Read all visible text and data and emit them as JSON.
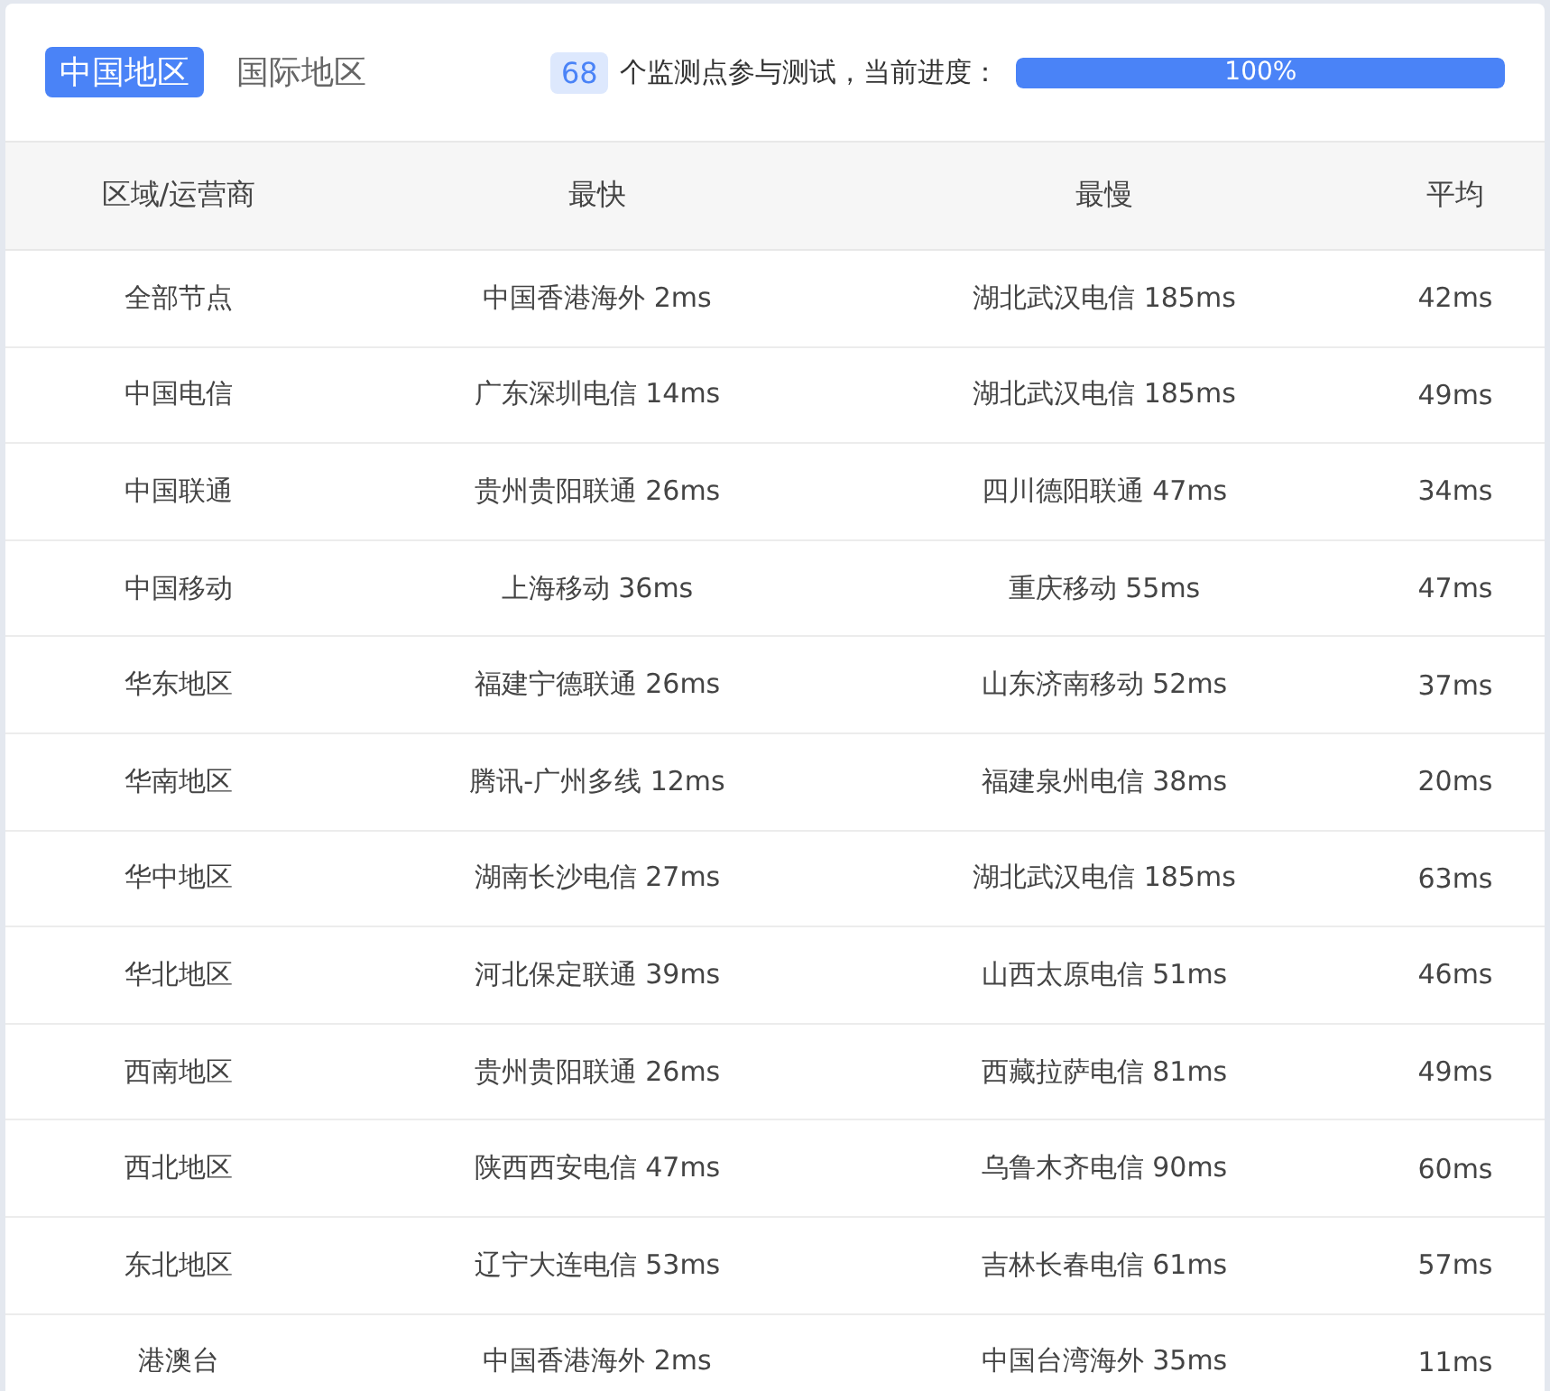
{
  "tabs": [
    {
      "label": "中国地区",
      "selected": true
    },
    {
      "label": "国际地区",
      "selected": false
    }
  ],
  "progress": {
    "count": "68",
    "text": "个监测点参与测试，当前进度：",
    "level": 1,
    "reading": "100%"
  },
  "table": {
    "columns": [
      "区域/运营商",
      "最快",
      "最慢",
      "平均"
    ],
    "rows": [
      [
        "全部节点",
        "中国香港海外 2ms",
        "湖北武汉电信 185ms",
        "42ms"
      ],
      [
        "中国电信",
        "广东深圳电信 14ms",
        "湖北武汉电信 185ms",
        "49ms"
      ],
      [
        "中国联通",
        "贵州贵阳联通 26ms",
        "四川德阳联通 47ms",
        "34ms"
      ],
      [
        "中国移动",
        "上海移动 36ms",
        "重庆移动 55ms",
        "47ms"
      ],
      [
        "华东地区",
        "福建宁德联通 26ms",
        "山东济南移动 52ms",
        "37ms"
      ],
      [
        "华南地区",
        "腾讯-广州多线 12ms",
        "福建泉州电信 38ms",
        "20ms"
      ],
      [
        "华中地区",
        "湖南长沙电信 27ms",
        "湖北武汉电信 185ms",
        "63ms"
      ],
      [
        "华北地区",
        "河北保定联通 39ms",
        "山西太原电信 51ms",
        "46ms"
      ],
      [
        "西南地区",
        "贵州贵阳联通 26ms",
        "西藏拉萨电信 81ms",
        "49ms"
      ],
      [
        "西北地区",
        "陕西西安电信 47ms",
        "乌鲁木齐电信 90ms",
        "60ms"
      ],
      [
        "东北地区",
        "辽宁大连电信 53ms",
        "吉林长春电信 61ms",
        "57ms"
      ],
      [
        "港澳台",
        "中国香港海外 2ms",
        "中国台湾海外 35ms",
        "11ms"
      ]
    ]
  }
}
